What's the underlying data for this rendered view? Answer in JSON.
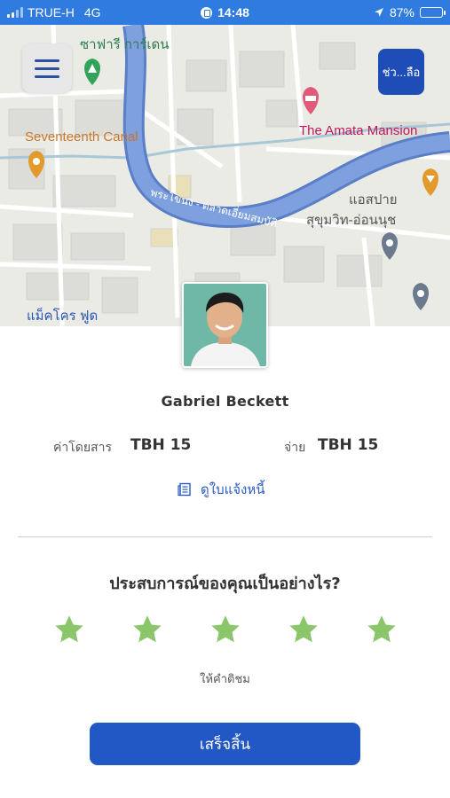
{
  "status_bar": {
    "carrier": "TRUE-H",
    "network": "4G",
    "time": "14:48",
    "battery": "87%",
    "battery_level": 0.87
  },
  "map": {
    "labels": {
      "safari": "ซาฟารี การ์เดน",
      "canal": "Seventeenth Canal",
      "amata": "The Amata Mansion",
      "spa": "แอสปาย",
      "sukhumvit": "สุขุมวิท-อ่อนนุช",
      "makro": "แม็คโคร ฟูด",
      "river": "พระโขนง - ตลาดเอี่ยมสมบัติ"
    },
    "help_button": "ช่ว...ลือ"
  },
  "driver": {
    "name": "Gabriel Beckett"
  },
  "fare": {
    "fare_label": "ค่าโดยสาร",
    "fare_value": "TBH 15",
    "pay_label": "จ่าย",
    "pay_value": "TBH 15"
  },
  "receipt_link": "ดูใบแจ้งหนี้",
  "rating": {
    "question": "ประสบการณ์ของคุณเป็นอย่างไร?",
    "stars": 5,
    "hint": "ให้คำติชม",
    "star_color": "#8cc66b"
  },
  "done_button": "เสร็จสิ้น",
  "colors": {
    "accent": "#2258c6",
    "status_bar": "#2f7be0"
  }
}
